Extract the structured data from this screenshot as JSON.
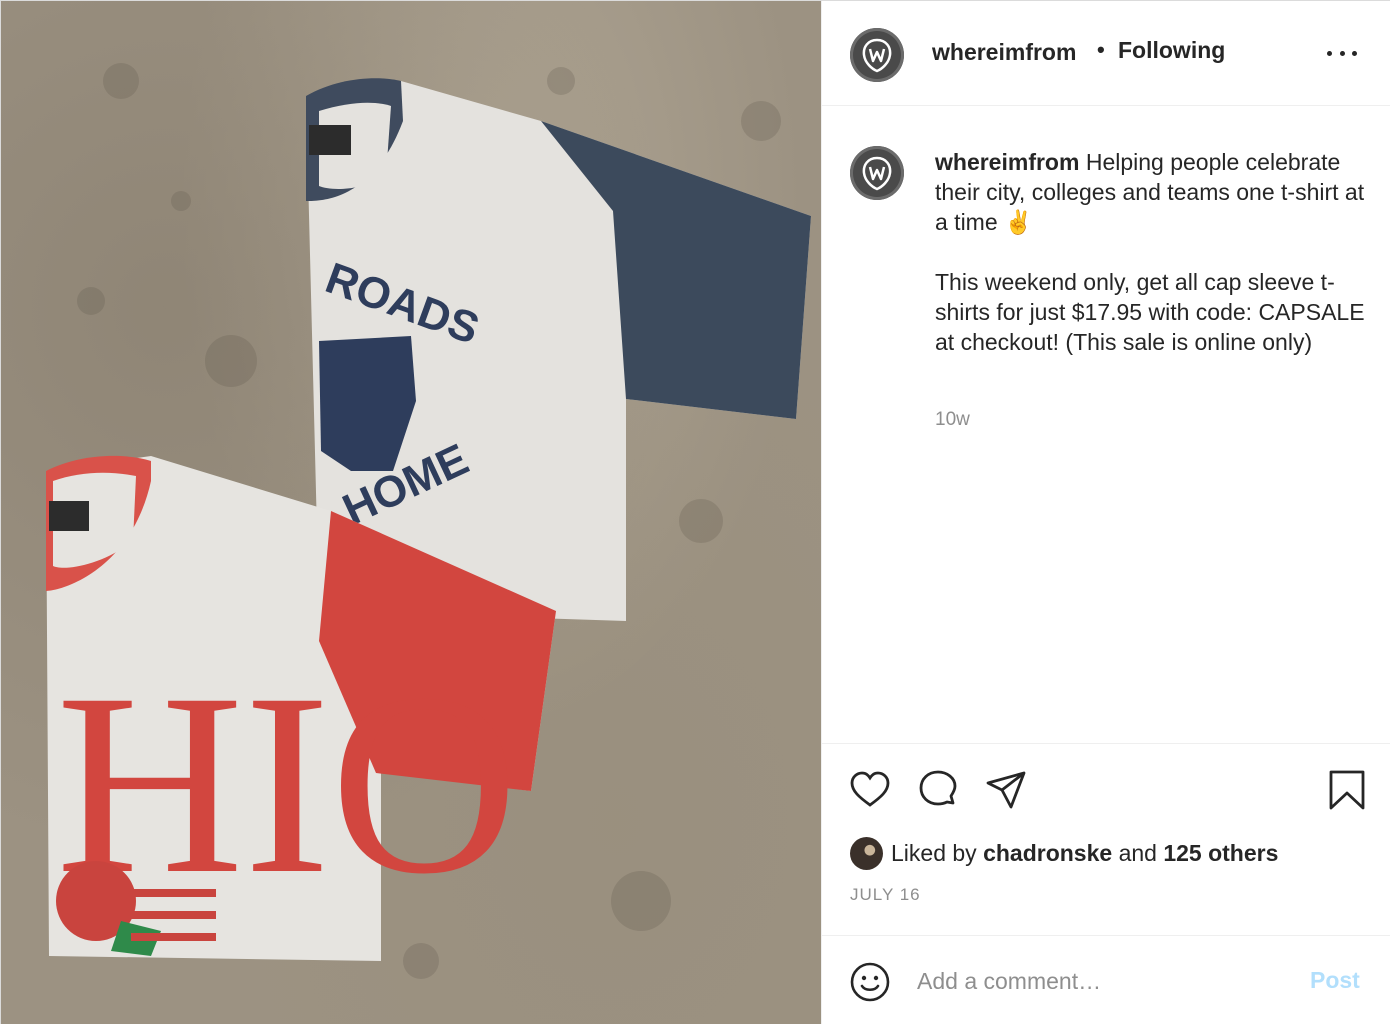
{
  "header": {
    "username": "whereimfrom",
    "separator": "•",
    "follow_status": "Following",
    "avatar_icon": "brand-logo-icon",
    "more_icon": "more-options-icon"
  },
  "photo": {
    "alt_icons": [
      "tshirt-navy-sleeve",
      "tshirt-red-sleeve"
    ],
    "shirt_top_text": "ROADS",
    "shirt_top_text_bottom": "HOME",
    "shirt_bottom_text": "HIO"
  },
  "caption": {
    "username": "whereimfrom",
    "line1": "Helping people celebrate their city, colleges and teams one t-shirt at a time ✌️",
    "line2": "This weekend only, get all cap sleeve t-shirts for just $17.95 with code: CAPSALE at checkout! (This sale is online only)",
    "age": "10w"
  },
  "actions": {
    "icons": [
      "heart-icon",
      "comment-icon",
      "share-icon",
      "bookmark-icon"
    ],
    "liked_prefix": "Liked by",
    "liked_user": "chadronske",
    "liked_and": "and",
    "liked_others": "125 others",
    "date": "JULY 16"
  },
  "comment": {
    "placeholder": "Add a comment…",
    "post_label": "Post",
    "emoji_icon": "smiley-icon"
  },
  "colors": {
    "text": "#262626",
    "muted": "#8e8e8e",
    "post_disabled": "#b2dffc",
    "divider": "#efefef"
  }
}
